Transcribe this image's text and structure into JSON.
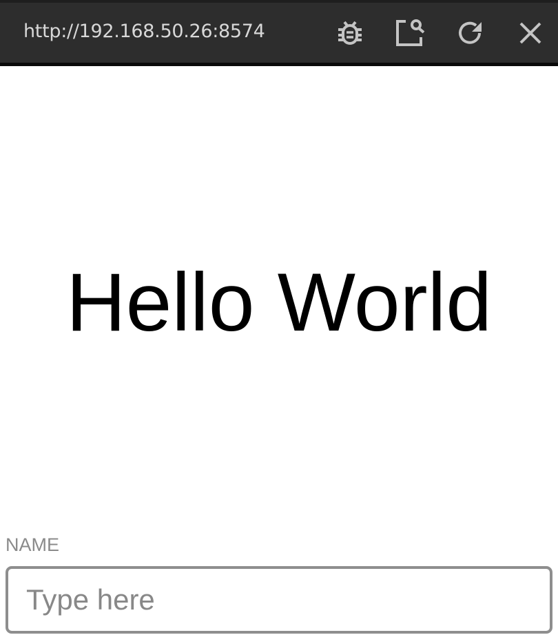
{
  "browser": {
    "url": "http://192.168.50.26:8574",
    "icons": [
      "bug-icon",
      "inspect-icon",
      "reload-icon",
      "close-icon"
    ]
  },
  "main": {
    "heading": "Hello World",
    "name_label": "NAME",
    "name_placeholder": "Type here",
    "name_value": ""
  }
}
